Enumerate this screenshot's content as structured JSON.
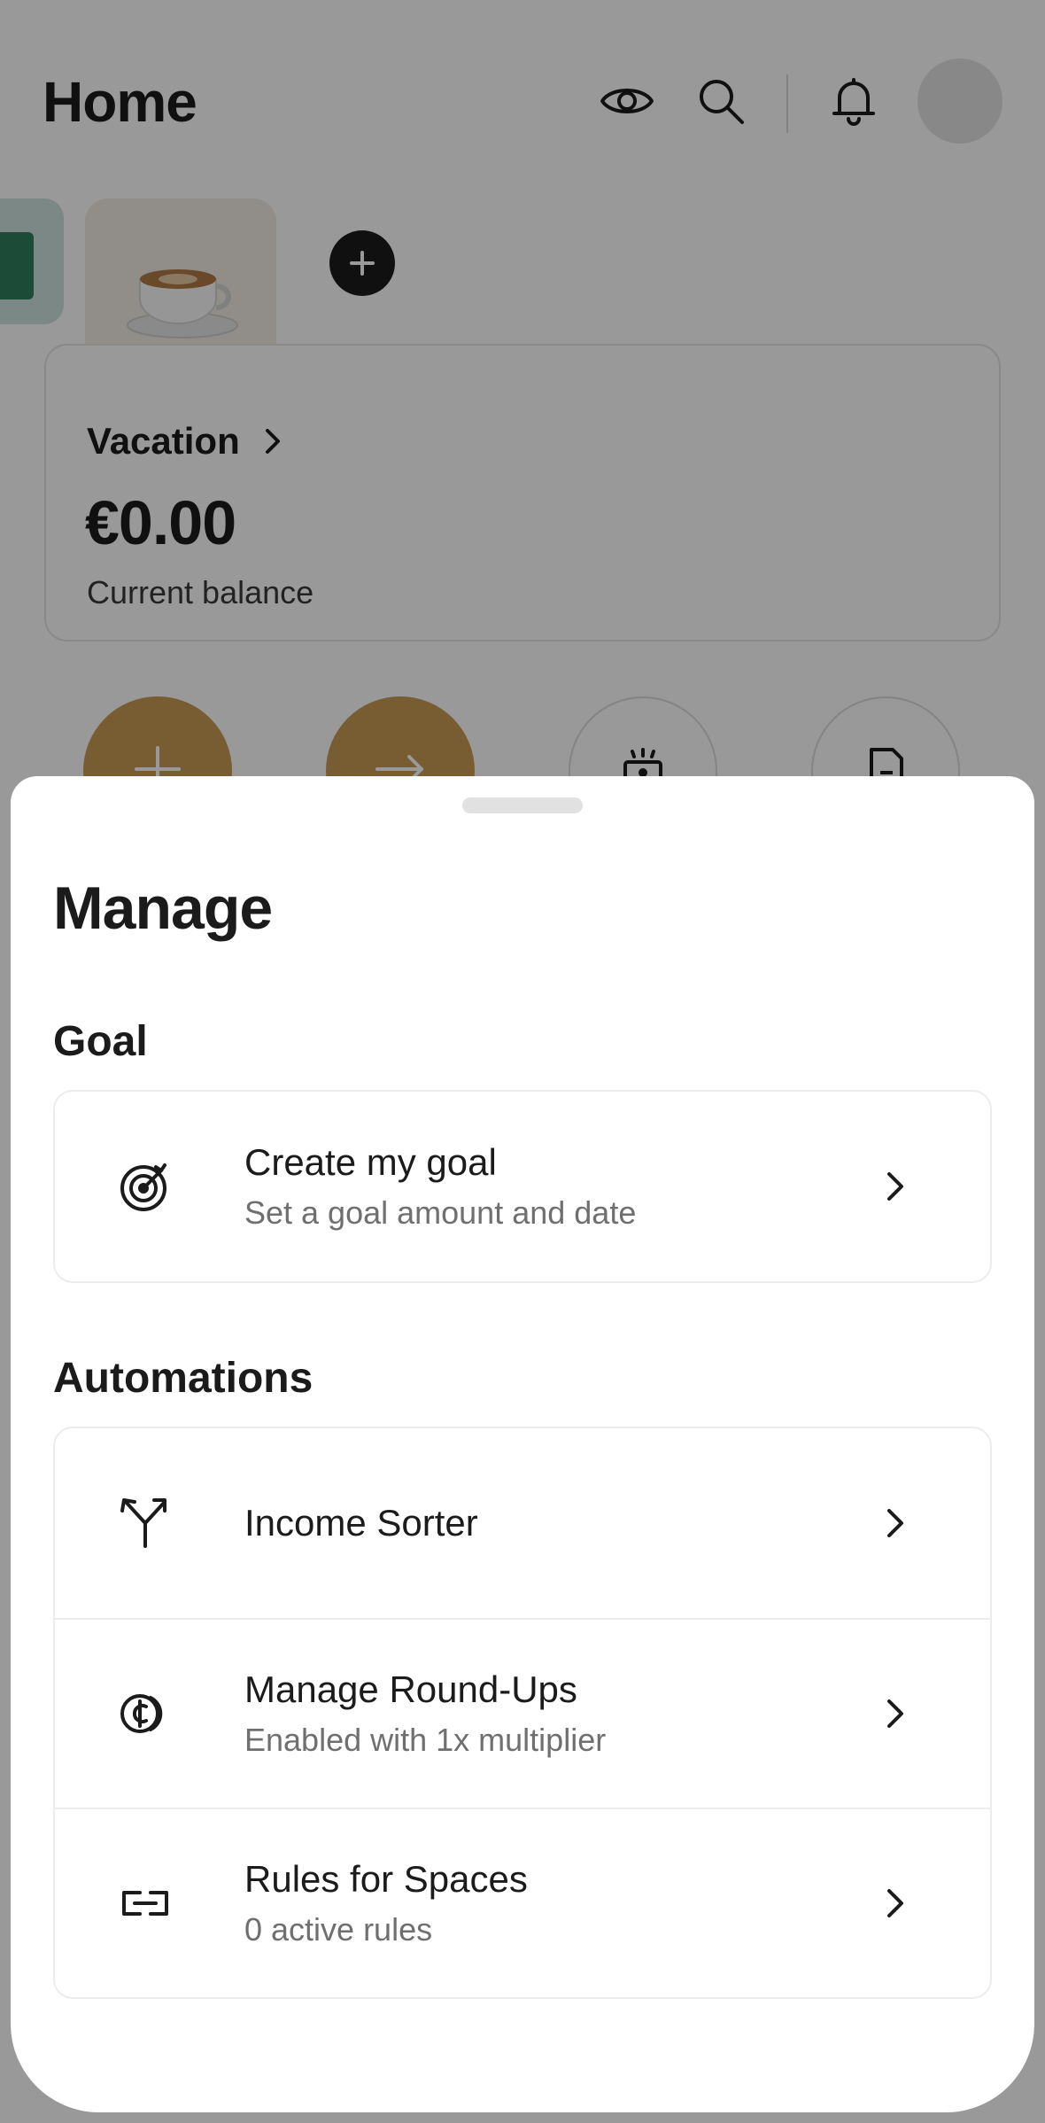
{
  "home": {
    "title": "Home",
    "space": {
      "name": "Vacation",
      "balance": "€0.00",
      "balance_label": "Current balance"
    },
    "header_icons": [
      "eye-icon",
      "search-icon",
      "bell-icon"
    ]
  },
  "sheet": {
    "title": "Manage",
    "goal_section": {
      "title": "Goal",
      "items": [
        {
          "label": "Create my goal",
          "sub": "Set a goal amount and date",
          "icon": "target-icon"
        }
      ]
    },
    "automations_section": {
      "title": "Automations",
      "items": [
        {
          "label": "Income Sorter",
          "sub": "",
          "icon": "split-arrows-icon"
        },
        {
          "label": "Manage Round-Ups",
          "sub": "Enabled with 1x multiplier",
          "icon": "round-up-coin-icon"
        },
        {
          "label": "Rules for Spaces",
          "sub": "0 active rules",
          "icon": "link-icon"
        }
      ]
    }
  },
  "colors": {
    "accent_gold": "#c99a54",
    "text_primary": "#1b1b1b",
    "text_secondary": "#6f6f6f",
    "scrim": "rgba(0,0,0,0.40)"
  }
}
